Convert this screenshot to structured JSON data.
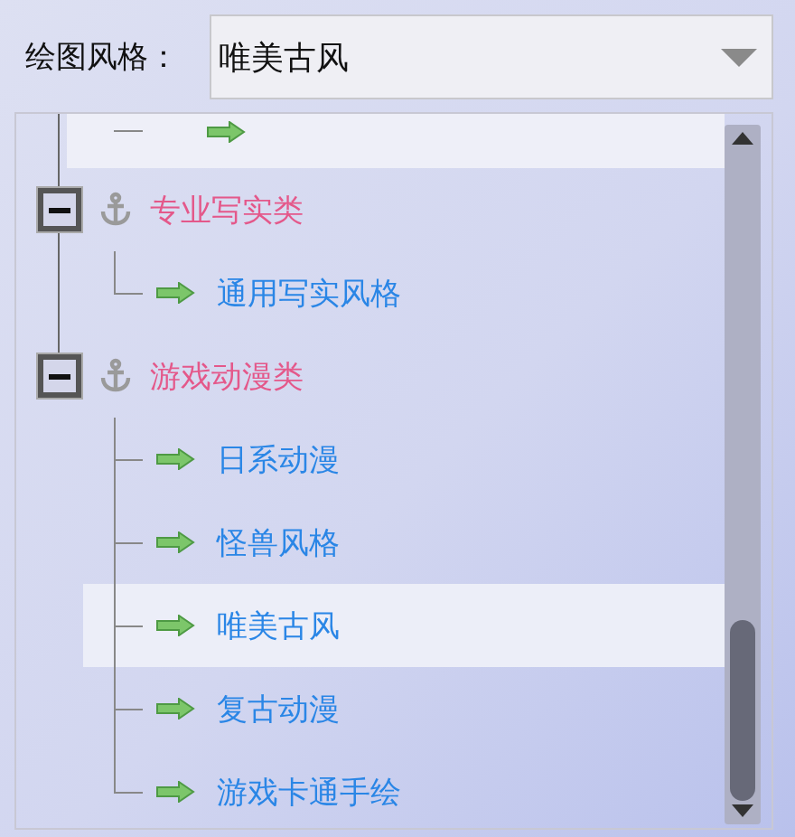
{
  "style_field": {
    "label": "绘图风格：",
    "value": "唯美古风"
  },
  "tree": [
    {
      "kind": "cut-leaf",
      "highlighted": true
    },
    {
      "kind": "group",
      "label": "专业写实类",
      "expanded": true,
      "children": [
        {
          "label": "通用写实风格",
          "selected": false
        }
      ]
    },
    {
      "kind": "group",
      "label": "游戏动漫类",
      "expanded": true,
      "children": [
        {
          "label": "日系动漫",
          "selected": false
        },
        {
          "label": "怪兽风格",
          "selected": false
        },
        {
          "label": "唯美古风",
          "selected": true
        },
        {
          "label": "复古动漫",
          "selected": false
        },
        {
          "label": "游戏卡通手绘",
          "selected": false
        }
      ]
    }
  ]
}
